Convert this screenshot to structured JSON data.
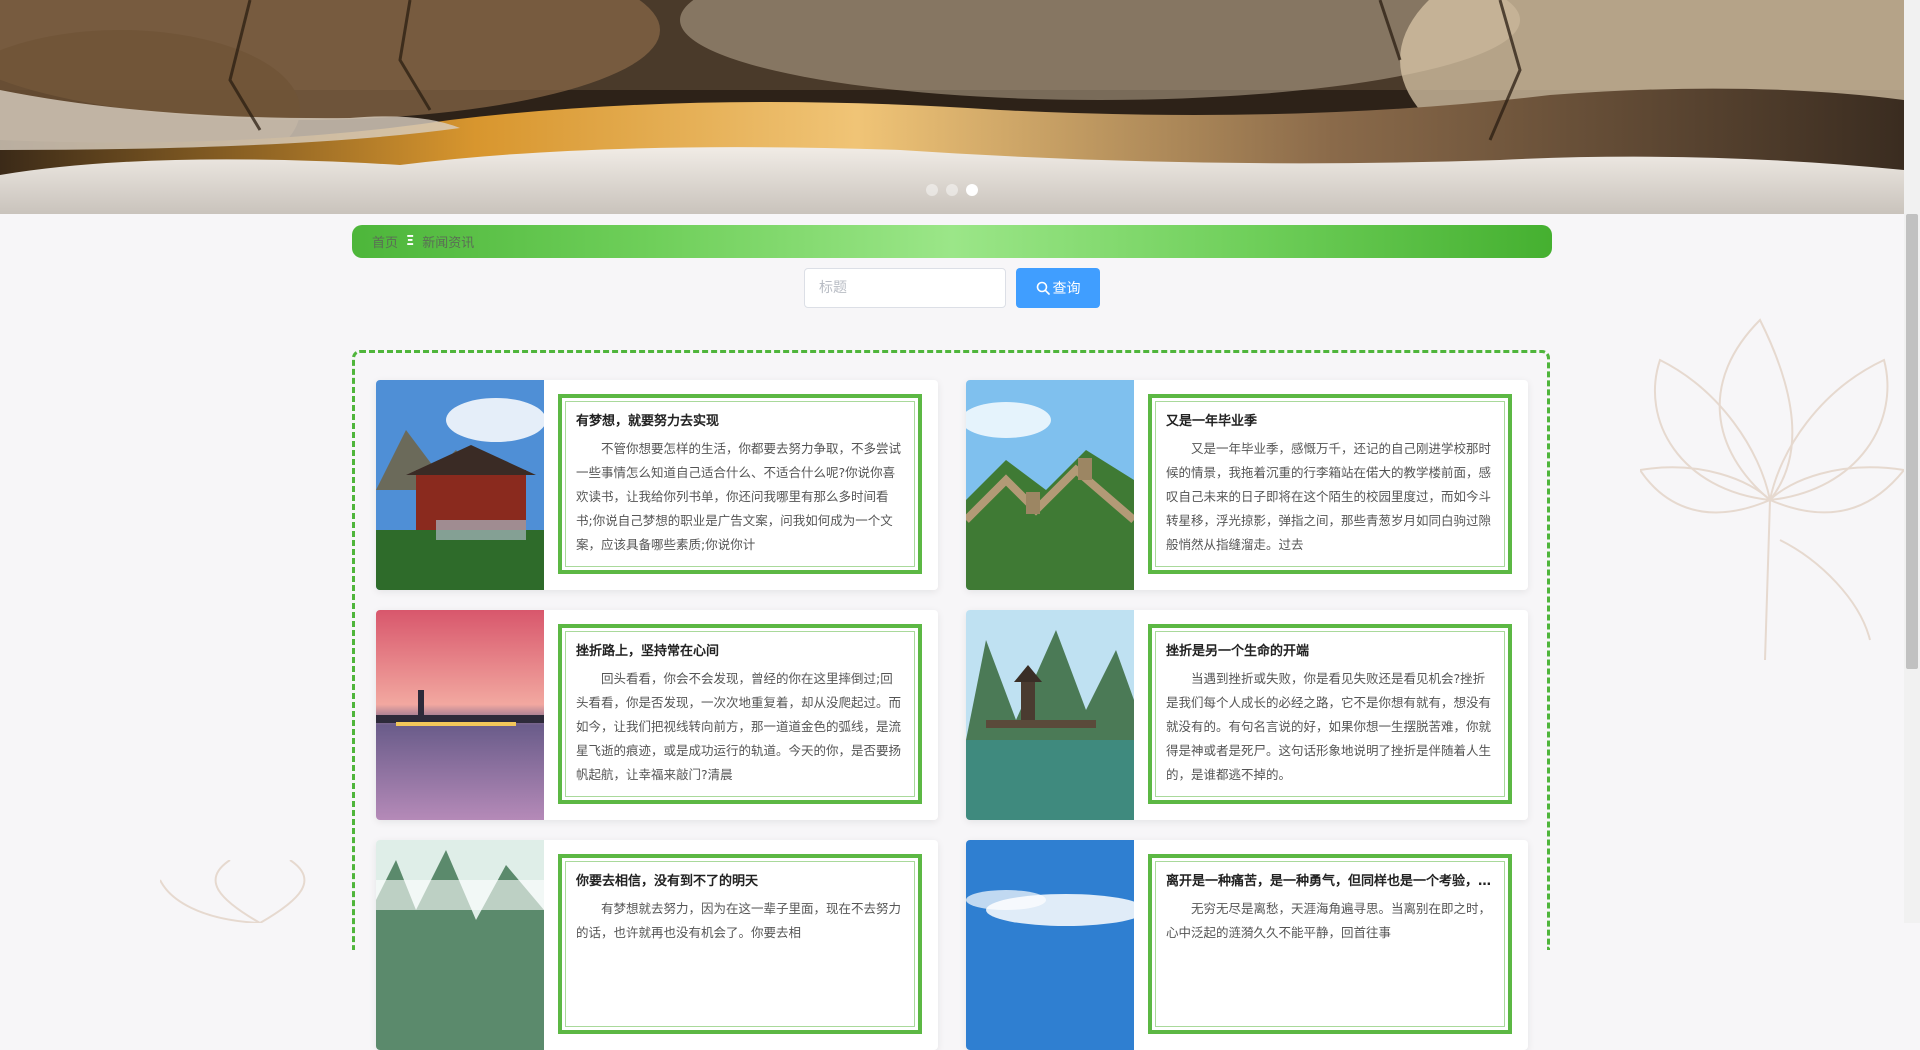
{
  "hero": {
    "slides": 3,
    "active_slide": 3
  },
  "breadcrumb": {
    "home": "首页",
    "separator": "Ξ",
    "current": "新闻资讯"
  },
  "search": {
    "placeholder": "标题",
    "value": "",
    "button_label": "查询",
    "button_icon": "search-icon"
  },
  "colors": {
    "accent_green": "#4fb53b",
    "button_blue": "#409eff"
  },
  "news": [
    {
      "title": "有梦想，就要努力去实现",
      "excerpt": "不管你想要怎样的生活，你都要去努力争取，不多尝试一些事情怎么知道自己适合什么、不适合什么呢?你说你喜欢读书，让我给你列书单，你还问我哪里有那么多时间看书;你说自己梦想的职业是广告文案，问我如何成为一个文案，应该具备哪些素质;你说你计",
      "image": "karst-pavilion"
    },
    {
      "title": "又是一年毕业季",
      "excerpt": "又是一年毕业季，感慨万千，还记的自己刚进学校那时候的情景，我拖着沉重的行李箱站在偌大的教学楼前面，感叹自己未来的日子即将在这个陌生的校园里度过，而如今斗转星移，浮光掠影，弹指之间，那些青葱岁月如同白驹过隙般悄然从指缝溜走。过去",
      "image": "great-wall"
    },
    {
      "title": "挫折路上，坚持常在心间",
      "excerpt": "回头看看，你会不会发现，曾经的你在这里摔倒过;回头看看，你是否发现，一次次地重复着，却从没爬起过。而如今，让我们把视线转向前方，那一道道金色的弧线，是流星飞逝的痕迹，或是成功运行的轨道。今天的你，是否要扬帆起航，让幸福来敲门?清晨",
      "image": "sunset-lake"
    },
    {
      "title": "挫折是另一个生命的开端",
      "excerpt": "当遇到挫折或失败，你是看见失败还是看见机会?挫折是我们每个人成长的必经之路，它不是你想有就有，想没有就没有的。有句名言说的好，如果你想一生摆脱苦难，你就得是神或者是死尸。这句话形象地说明了挫折是伴随着人生的，是谁都逃不掉的。",
      "image": "river-bridge"
    },
    {
      "title": "你要去相信，没有到不了的明天",
      "excerpt": "有梦想就去努力，因为在这一辈子里面，现在不去努力的话，也许就再也没有机会了。你要去相",
      "image": "misty-peaks"
    },
    {
      "title": "离开是一种痛苦，是一种勇气，但同样也是一个考验，是一个新的开始",
      "excerpt": "无穷无尽是离愁，天涯海角遍寻思。当离别在即之时，心中泛起的涟漪久久不能平静，回首往事",
      "image": "blue-sky"
    }
  ]
}
